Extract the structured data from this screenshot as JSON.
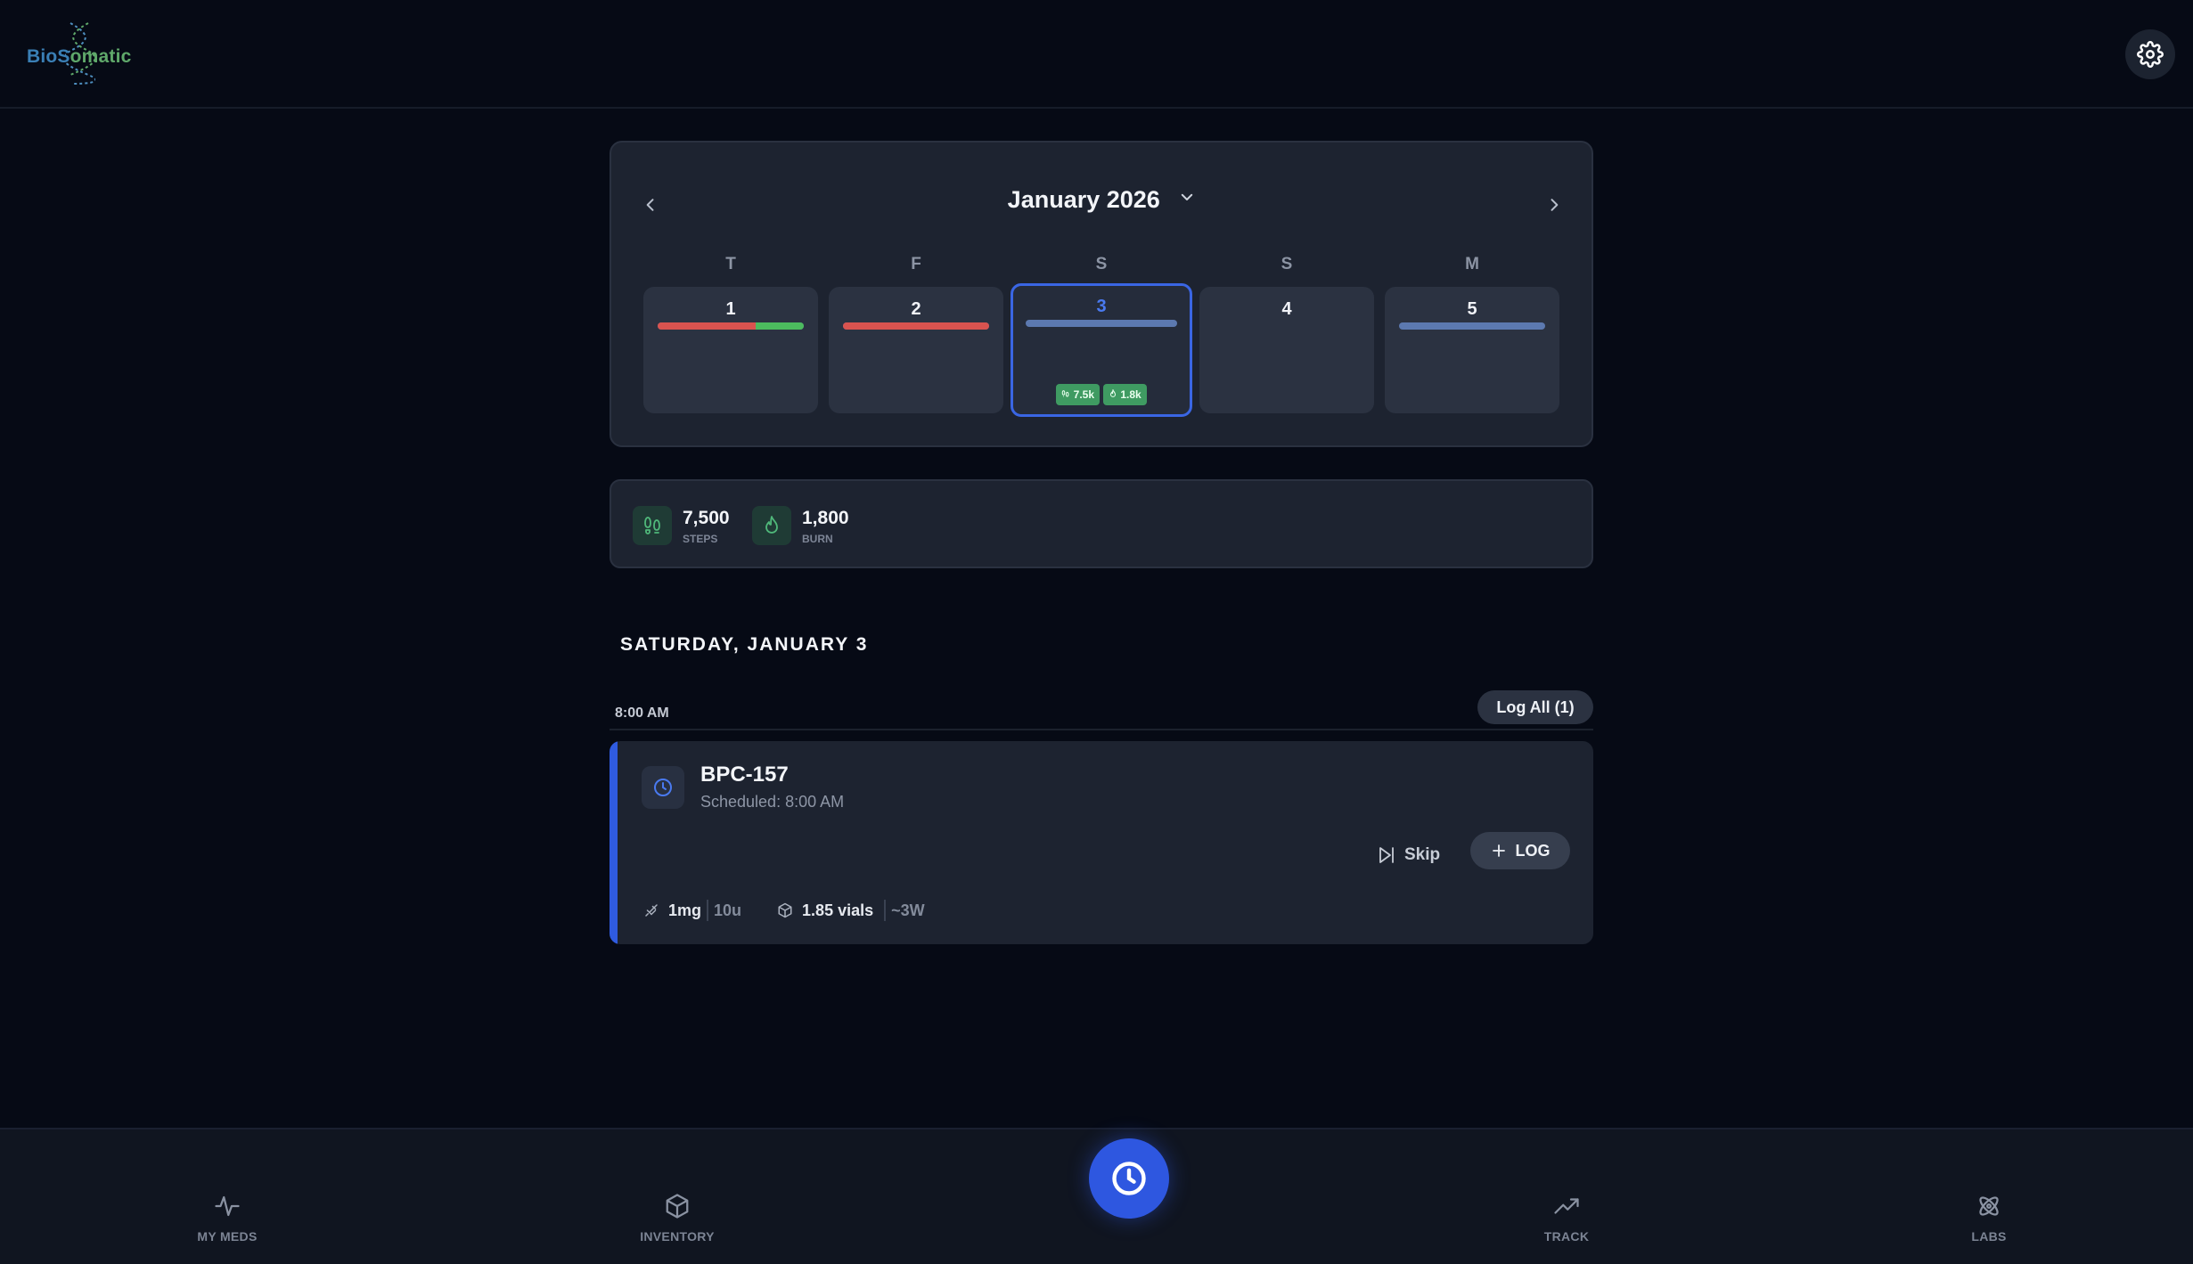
{
  "app": {
    "logo_part1": "BioS",
    "logo_part2": "omatic",
    "settings_icon": "gear-icon"
  },
  "calendar": {
    "month_label": "January 2026",
    "weekdays": [
      "T",
      "F",
      "S",
      "S",
      "M"
    ],
    "days": [
      {
        "num": "1",
        "bar": [
          "red",
          "green"
        ]
      },
      {
        "num": "2",
        "bar": [
          "red"
        ]
      },
      {
        "num": "3",
        "bar": [
          "blue"
        ],
        "selected": true,
        "badges": [
          "7.5k",
          "1.8k"
        ]
      },
      {
        "num": "4",
        "bar": []
      },
      {
        "num": "5",
        "bar": [
          "blue"
        ]
      }
    ]
  },
  "stats": [
    {
      "value": "7,500",
      "label": "STEPS",
      "icon": "footprints-icon"
    },
    {
      "value": "1,800",
      "label": "BURN",
      "icon": "flame-icon"
    }
  ],
  "day_heading": "SATURDAY, JANUARY 3",
  "schedule": {
    "time": "8:00 AM",
    "log_all_label": "Log All (1)",
    "med": {
      "name": "BPC-157",
      "scheduled": "Scheduled: 8:00 AM",
      "skip_label": "Skip",
      "log_label": "LOG",
      "dose": "1mg",
      "units": "10u",
      "vials": "1.85 vials",
      "duration": "~3W"
    }
  },
  "nav": {
    "items": [
      {
        "label": "MY MEDS",
        "icon": "activity-icon"
      },
      {
        "label": "INVENTORY",
        "icon": "box-icon"
      },
      {
        "label": "TRACK",
        "icon": "trending-up-icon"
      },
      {
        "label": "LABS",
        "icon": "atom-icon"
      }
    ],
    "center_icon": "clock-icon"
  },
  "colors": {
    "accent": "#2f5be0",
    "bar_red": "#d9534f",
    "bar_green": "#4cbb5e",
    "bar_blue": "#5c79b0",
    "badge_green": "#3f9b62"
  }
}
